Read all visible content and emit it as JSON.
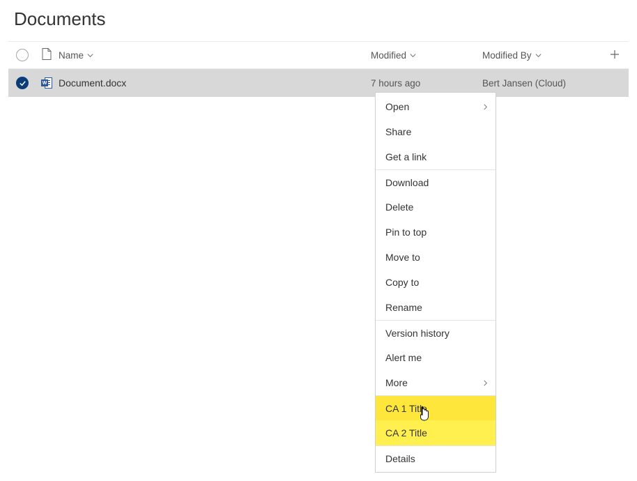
{
  "title": "Documents",
  "columns": {
    "name": "Name",
    "modified": "Modified",
    "modified_by": "Modified By"
  },
  "rows": [
    {
      "name": "Document.docx",
      "modified": "7 hours ago",
      "modified_by": "Bert Jansen (Cloud)",
      "selected": true
    }
  ],
  "context_menu": [
    {
      "label": "Open",
      "submenu": true
    },
    {
      "label": "Share"
    },
    {
      "label": "Get a link"
    },
    {
      "label": "Download",
      "separator": true
    },
    {
      "label": "Delete"
    },
    {
      "label": "Pin to top"
    },
    {
      "label": "Move to"
    },
    {
      "label": "Copy to"
    },
    {
      "label": "Rename"
    },
    {
      "label": "Version history",
      "separator": true
    },
    {
      "label": "Alert me"
    },
    {
      "label": "More",
      "submenu": true
    },
    {
      "label": "CA 1 Title",
      "highlight": 1,
      "separator": true
    },
    {
      "label": "CA 2 Title",
      "highlight": 2
    },
    {
      "label": "Details",
      "separator": true
    }
  ]
}
